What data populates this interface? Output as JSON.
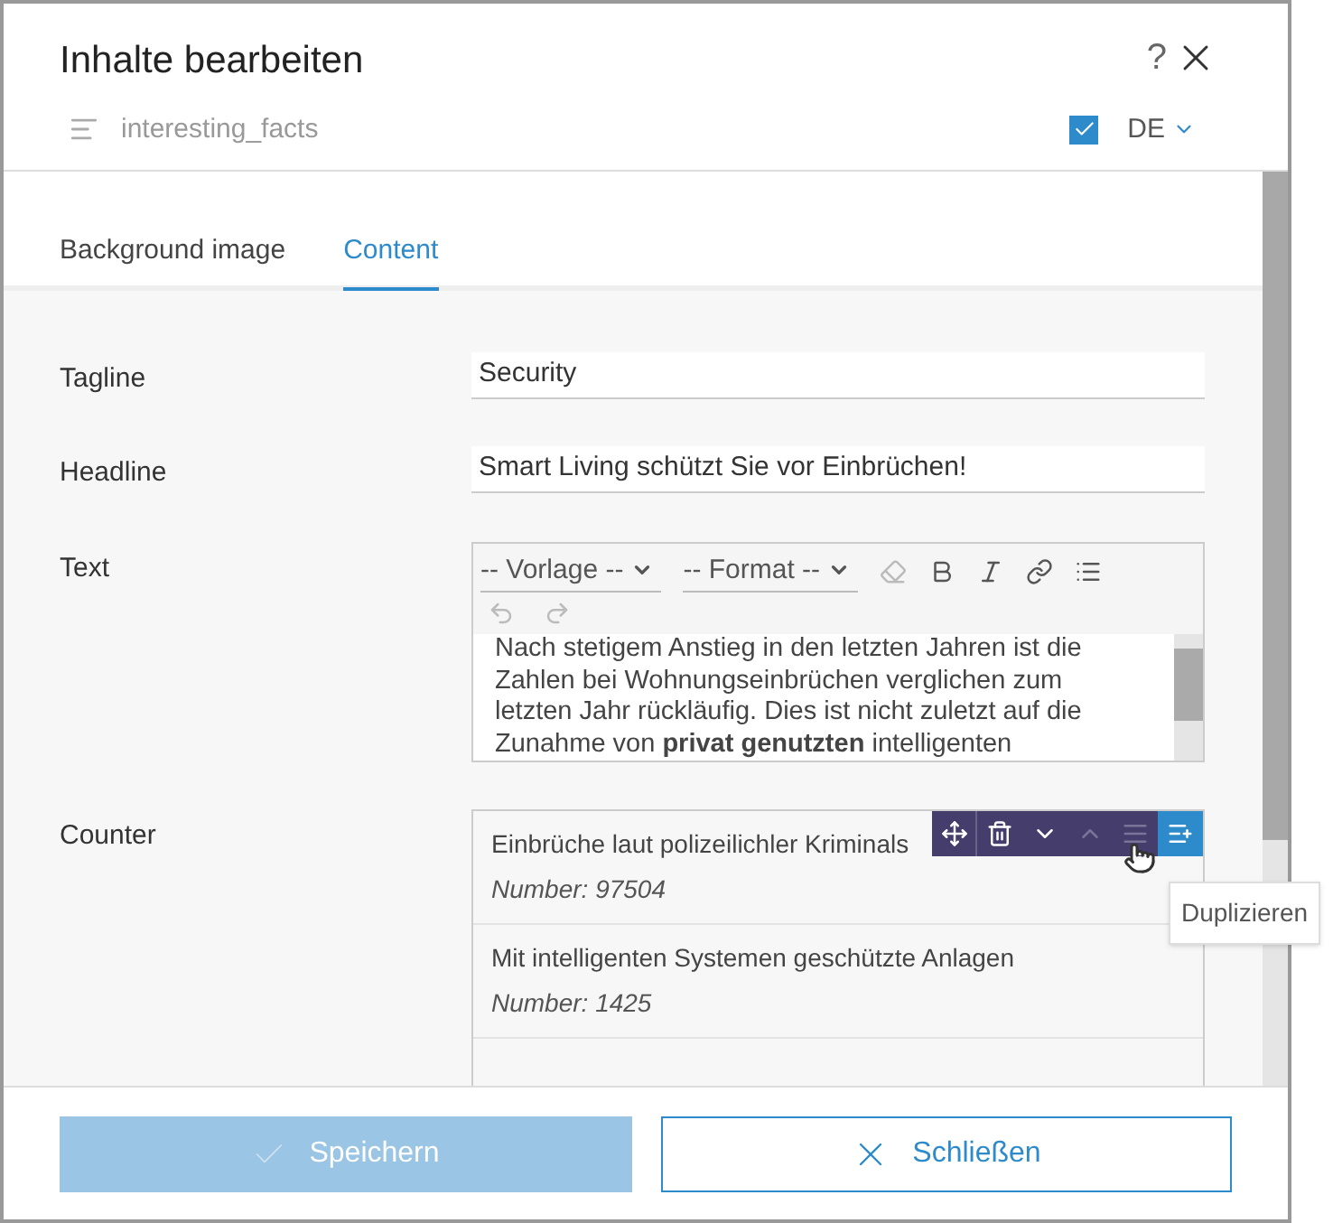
{
  "dialog": {
    "title": "Inhalte bearbeiten",
    "help": "?",
    "element_name": "interesting_facts",
    "published": {
      "checked": true
    },
    "language": "DE"
  },
  "tabs": [
    {
      "label": "Background image",
      "selected": false
    },
    {
      "label": "Content",
      "selected": true
    }
  ],
  "fields": [
    {
      "kind": "input",
      "label": "Tagline",
      "value": "Security"
    },
    {
      "kind": "input",
      "label": "Headline",
      "value": "Smart Living schützt Sie vor Einbrüchen!"
    },
    {
      "kind": "richtext",
      "label": "Text",
      "template_select": "-- Vorlage --",
      "format_select": "-- Format --",
      "content": "Nach stetigem Anstieg in den letzten Jahren ist die Zahlen bei Wohnungseinbrüchen verglichen zum letzten Jahr rückläufig. Dies ist nicht zuletzt auf die Zunahme von **privat genutzten** intelligenten"
    },
    {
      "kind": "list",
      "label": "Counter",
      "items": [
        {
          "title": "Einbrüche laut polizeilichler Kriminals",
          "number": "Number: 97504"
        },
        {
          "title": "Mit intelligenten Systemen geschützte Anlagen",
          "number": "Number: 1425"
        }
      ]
    }
  ],
  "item_toolbar": [
    {
      "kind": "move",
      "disabled": false,
      "selected": false
    },
    {
      "kind": "delete",
      "disabled": false,
      "selected": false
    },
    {
      "kind": "down",
      "disabled": false,
      "selected": false
    },
    {
      "kind": "up",
      "disabled": true,
      "selected": false
    },
    {
      "kind": "list",
      "disabled": true,
      "selected": false
    },
    {
      "kind": "duplicate",
      "disabled": false,
      "selected": true
    }
  ],
  "tooltip": "Duplizieren",
  "footer": [
    {
      "kind": "save",
      "label": "Speichern",
      "disabled": true
    },
    {
      "kind": "close",
      "label": "Schließen",
      "disabled": false
    }
  ]
}
